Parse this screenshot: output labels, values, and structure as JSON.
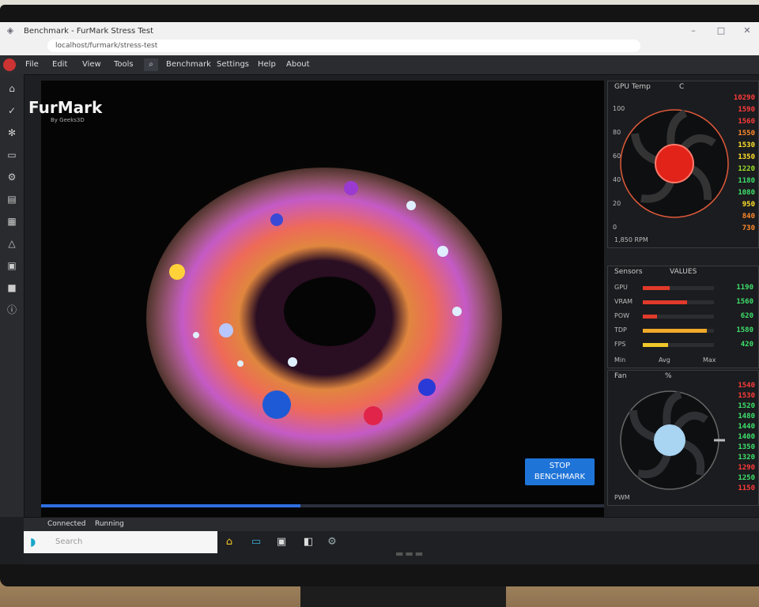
{
  "app": {
    "logo": "FurMark",
    "logo_sub": "By Geeks3D"
  },
  "browser": {
    "tab_title": "Benchmark - FurMark Stress Test",
    "address": "localhost/furmark/stress-test"
  },
  "menu": [
    "File",
    "Edit",
    "View",
    "Tools",
    "Benchmark",
    "Settings",
    "Help",
    "About"
  ],
  "left_icons": [
    "home-icon",
    "check-icon",
    "fan-icon",
    "monitor-icon",
    "settings-icon",
    "chart-icon",
    "gpu-icon",
    "cloud-icon",
    "screenshot-icon",
    "stop-icon",
    "info-icon"
  ],
  "viewport": {
    "stop_button": "STOP",
    "stop_sub": "BENCHMARK",
    "progress": 0.46
  },
  "panel1": {
    "title": "GPU Temp",
    "unit": "C",
    "scale_labels": [
      "100",
      "80",
      "60",
      "40",
      "20",
      "0"
    ],
    "readings": [
      "10290",
      "1590",
      "1560",
      "1550",
      "1530",
      "1350",
      "1220",
      "1180",
      "1080",
      "950",
      "840",
      "730"
    ],
    "reading_colors": [
      "#ff3b3b",
      "#ff3b3b",
      "#ff3b3b",
      "#ff8a2b",
      "#ffe02b",
      "#ffe02b",
      "#9be22b",
      "#3ee06b",
      "#3ee06b",
      "#ffe02b",
      "#ff8a2b",
      "#ff8a2b"
    ],
    "footer": "1,850 RPM"
  },
  "panel2": {
    "title": "Sensors",
    "right_title": "VALUES",
    "bars": [
      {
        "label": "GPU",
        "value": 0.38,
        "color": "#e03a2b",
        "reading": "1190"
      },
      {
        "label": "VRAM",
        "value": 0.62,
        "color": "#e03a2b",
        "reading": "1560"
      },
      {
        "label": "POW",
        "value": 0.2,
        "color": "#e03a2b",
        "reading": "620"
      },
      {
        "label": "TDP",
        "value": 0.9,
        "color": "#f0a92b",
        "reading": "1580"
      },
      {
        "label": "FPS",
        "value": 0.35,
        "color": "#f0c82b",
        "reading": "420"
      }
    ],
    "footer": [
      "Min",
      "Avg",
      "Max"
    ]
  },
  "panel3": {
    "title": "Fan",
    "unit": "%",
    "readings": [
      "1540",
      "1530",
      "1520",
      "1480",
      "1440",
      "1400",
      "1350",
      "1320",
      "1290",
      "1250",
      "1150"
    ],
    "reading_colors": [
      "#ff3b3b",
      "#ff3b3b",
      "#3ee06b",
      "#3ee06b",
      "#3ee06b",
      "#3ee06b",
      "#3ee06b",
      "#3ee06b",
      "#ff3b3b",
      "#3ee06b",
      "#ff3b3b"
    ],
    "footer": "PWM"
  },
  "bottombar": {
    "left1": "Connected",
    "left2": "Running"
  },
  "taskbar": {
    "search_placeholder": "Search",
    "icons": [
      "home-icon",
      "folder-icon",
      "store-icon",
      "edge-icon",
      "settings-icon"
    ]
  },
  "colors": {
    "accent": "#1f74d8",
    "screen_bg": "#1e1f22",
    "viewport_bg": "#050505"
  }
}
